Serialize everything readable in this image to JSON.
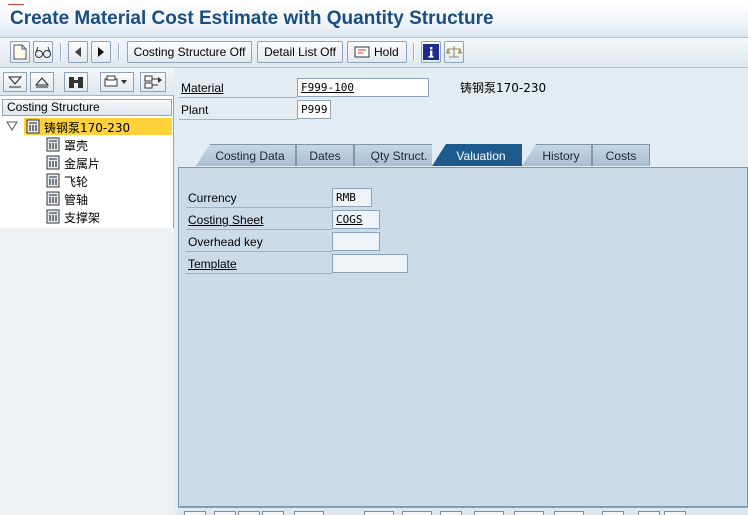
{
  "window": {
    "title": "Create Material Cost Estimate with Quantity Structure"
  },
  "toolbar": {
    "costing_structure_label": "Costing Structure Off",
    "detail_list_label": "Detail List Off",
    "hold_label": "Hold",
    "icons": [
      "new-document-icon",
      "glasses-icon",
      "previous-arrow-icon",
      "next-arrow-icon",
      "hold-icon",
      "info-icon",
      "scales-icon"
    ]
  },
  "tree": {
    "header": "Costing Structure",
    "root": {
      "label": "铸钢泵170-230"
    },
    "children": [
      {
        "label": "罩壳"
      },
      {
        "label": "金属片"
      },
      {
        "label": "飞轮"
      },
      {
        "label": "管轴"
      },
      {
        "label": "支撑架"
      }
    ]
  },
  "header_fields": {
    "material_label": "Material",
    "material_value": "F999-100",
    "material_desc": "铸钢泵170-230",
    "plant_label": "Plant",
    "plant_value": "P999"
  },
  "tabs": [
    {
      "label": "Costing Data"
    },
    {
      "label": "Dates"
    },
    {
      "label": "Qty Struct."
    },
    {
      "label": "Valuation",
      "active": true
    },
    {
      "label": "History"
    },
    {
      "label": "Costs"
    }
  ],
  "valuation": {
    "currency_label": "Currency",
    "currency_value": "RMB",
    "costing_sheet_label": "Costing Sheet",
    "costing_sheet_value": "COGS",
    "overhead_key_label": "Overhead key",
    "overhead_key_value": "",
    "template_label": "Template",
    "template_value": ""
  },
  "colors": {
    "title": "#1a4e80",
    "active_tab": "#1f5a8c",
    "tree_selection": "#ffd23a",
    "panel": "#ccdbe8"
  }
}
